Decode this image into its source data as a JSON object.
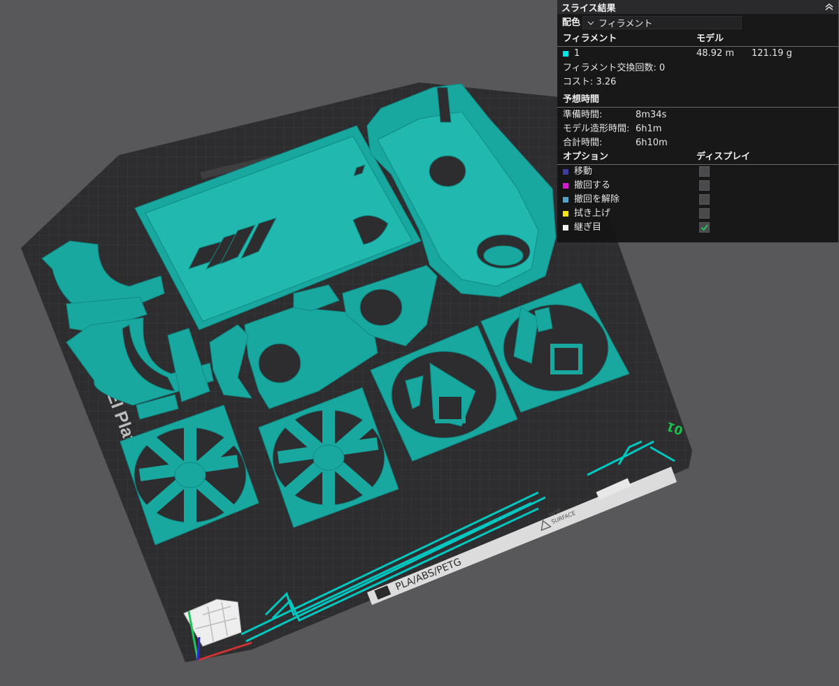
{
  "plate": {
    "name": "Bambu Textured PEI Plate",
    "plate_number": "01",
    "surface_strip": "PLA/ABS/PETG",
    "hot_surface_label": [
      "HOT",
      "SURFACE"
    ]
  },
  "panel": {
    "title": "スライス結果",
    "color_scheme_label": "配色",
    "color_scheme_value": "フィラメント",
    "filament_header": "フィラメント",
    "model_header": "モデル",
    "filament": {
      "color": "#00e5e5",
      "id": "1",
      "length": "48.92 m",
      "weight": "121.19 g"
    },
    "filament_changes": "フィラメント交換回数: 0",
    "cost": "コスト: 3.26",
    "estimate_header": "予想時間",
    "times": [
      {
        "label": "準備時間:",
        "value": "8m34s"
      },
      {
        "label": "モデル造形時間:",
        "value": "6h1m"
      },
      {
        "label": "合計時間:",
        "value": "6h10m"
      }
    ],
    "options_header": "オプション",
    "display_header": "ディスプレイ",
    "options": [
      {
        "label": "移動",
        "color": "#3d3d9e",
        "checked": false
      },
      {
        "label": "撤回する",
        "color": "#d21bd2",
        "checked": false
      },
      {
        "label": "撤回を解除",
        "color": "#4fa3c7",
        "checked": false
      },
      {
        "label": "拭き上げ",
        "color": "#f5e11a",
        "checked": false
      },
      {
        "label": "継ぎ目",
        "color": "#f0f0f0",
        "checked": true
      }
    ]
  }
}
